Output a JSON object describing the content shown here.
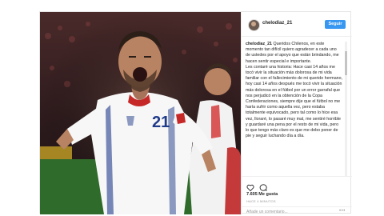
{
  "post": {
    "username": "chelodiaz_21",
    "follow_label": "Seguir",
    "caption_username": "chelodiaz_21",
    "caption_paragraphs": [
      "Queridos Chilenos, en este momento tan difícil quiero agradecer a cada uno de ustedes por el apoyo que están brindando, me hacen sentir especial e importante.",
      "Les contaré una historia: Hace casi 14 años me tocó vivir la situación más dolorosa de mi vida familiar con el fallecimiento de mi querido hermano, hoy casi 14 años después me tocó vivir la situación más dolorosa en el fútbol por un error garrafal que nos perjudicó en la obtención de la Copa Confederaciones, siempre dije que el fútbol no me haría sufrir como aquella vez, pero estaba totalmente equivocado, pero tal como lo hice esa vez, lloraré, lo pasaré muy mal, me sentiré horrible y guardaré una pena por el resto de mi vida, pero lo que tengo más claro es que me debo poner de pie y seguir luchando día a día."
    ],
    "likes": "7.605 Me gusta",
    "time_ago": "HACE 4 MINUTOS",
    "comment_placeholder": "Añade un comentario...",
    "more_dots": "•••",
    "photo_jersey_number": "21"
  },
  "icons": {
    "heart": "heart-icon",
    "comment": "comment-icon"
  },
  "colors": {
    "follow_button": "#3897f0",
    "jersey": "#ffffff",
    "stands": "#3a2323",
    "pitch": "#2f6b2a"
  }
}
